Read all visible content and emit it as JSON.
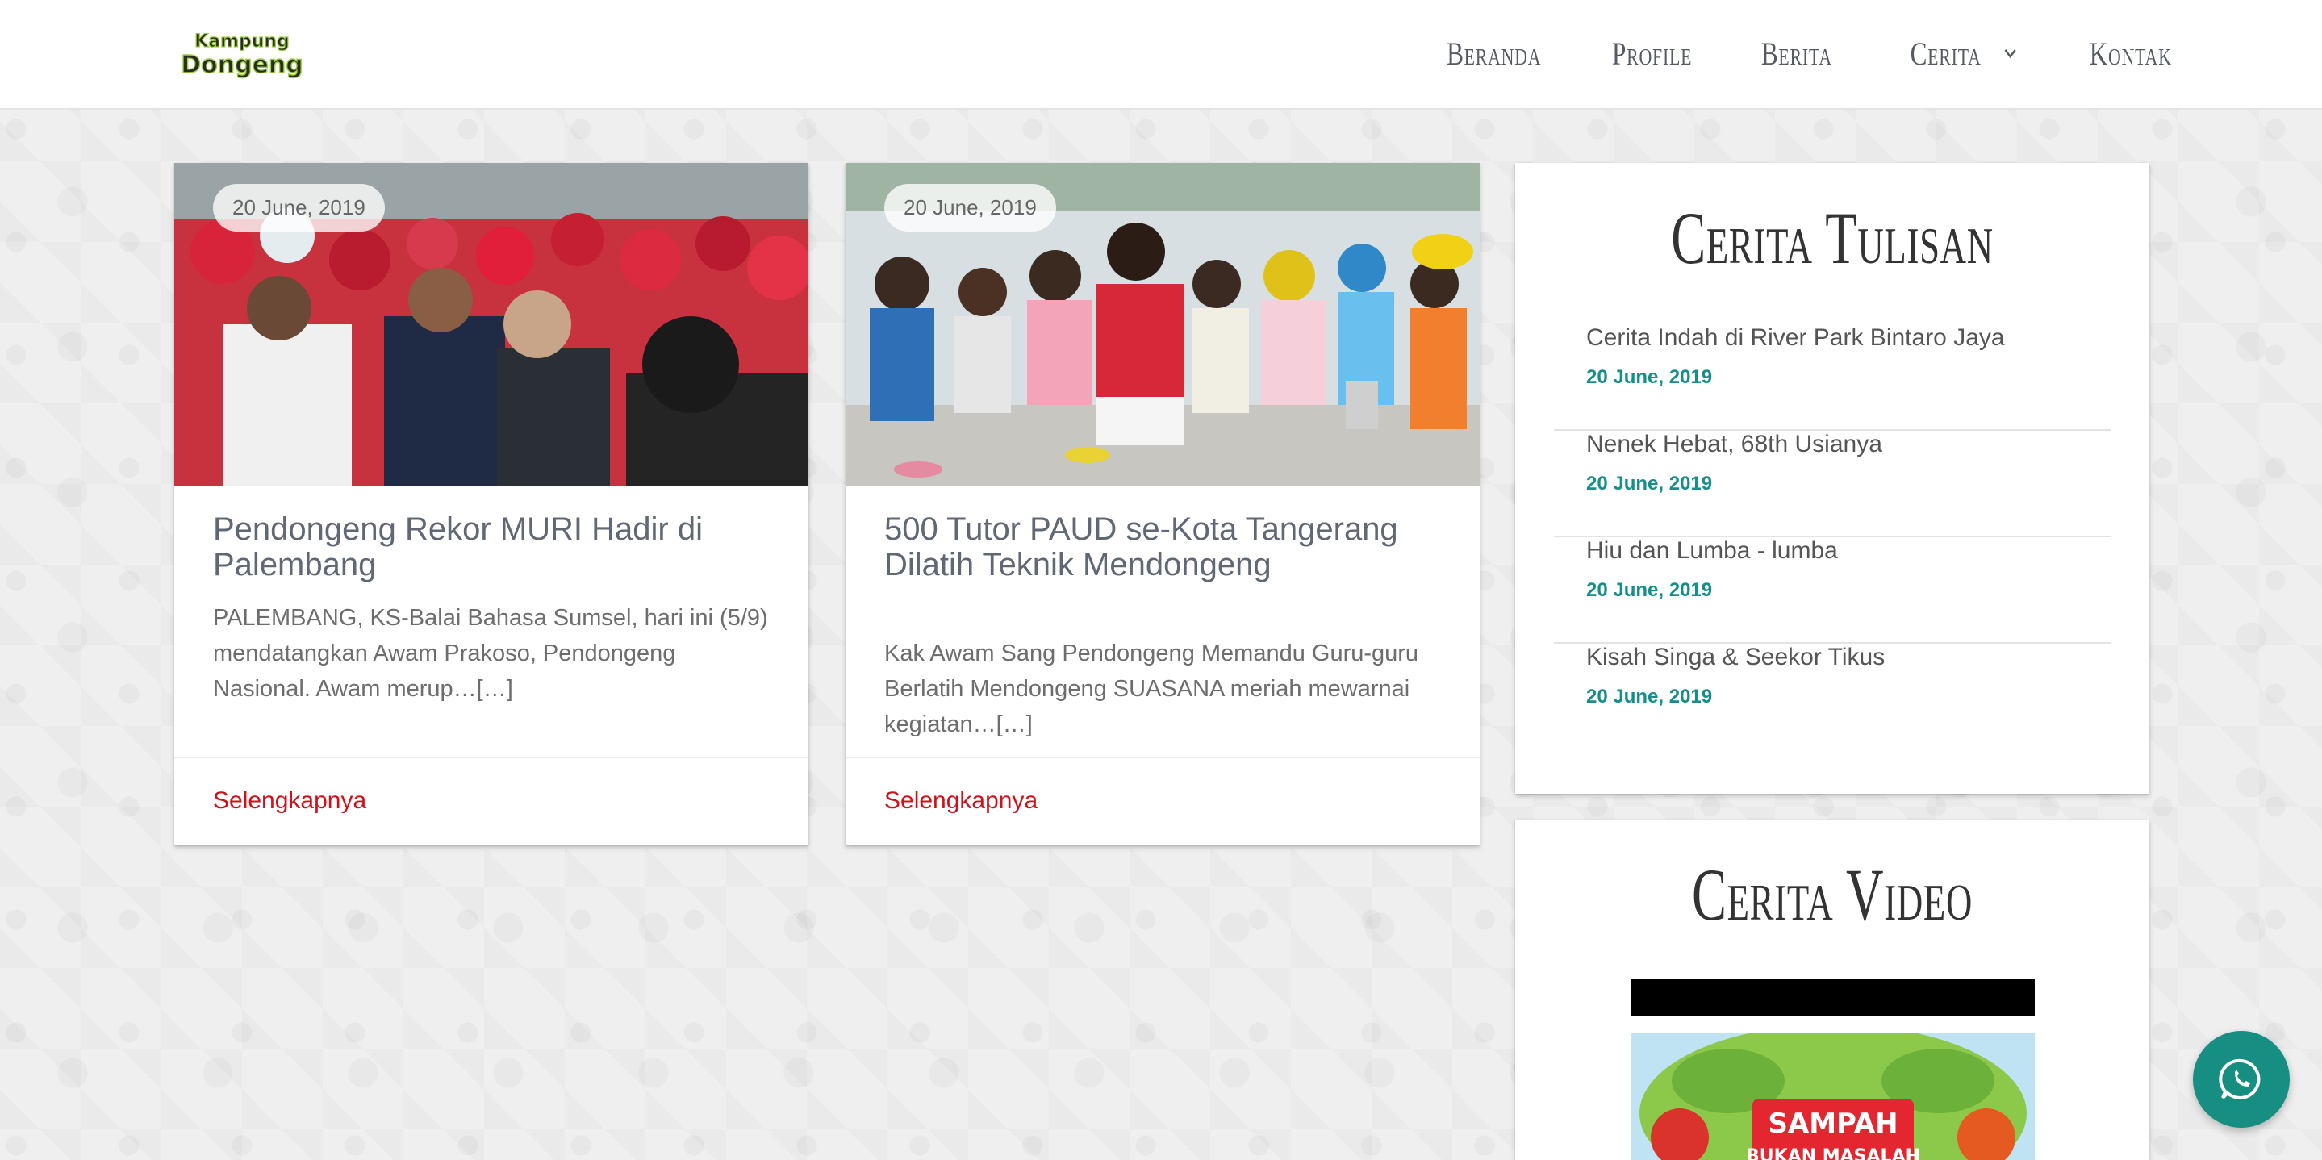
{
  "header": {
    "logo": {
      "line1": "Kampung",
      "line2": "Dongeng"
    },
    "nav": [
      {
        "label": "Beranda"
      },
      {
        "label": "Profile"
      },
      {
        "label": "Berita"
      },
      {
        "label": "Cerita"
      },
      {
        "label": "Kontak"
      }
    ]
  },
  "posts": [
    {
      "date": "20 June, 2019",
      "title": "Pendongeng Rekor MURI Hadir di Palembang",
      "excerpt": "PALEMBANG, KS-Balai Bahasa Sumsel, hari ini (5/9) mendatangkan Awam Prakoso, Pendongeng Nasional. Awam merup…[…]",
      "link": "Selengkapnya"
    },
    {
      "date": "20 June, 2019",
      "title": "500 Tutor PAUD se-Kota Tangerang Dilatih Teknik Mendongeng",
      "excerpt": "Kak Awam Sang Pendongeng Memandu Guru-guru Berlatih Mendongeng   SUASANA meriah mewarnai kegiatan…[…]",
      "link": "Selengkapnya"
    }
  ],
  "sidebar": {
    "written": {
      "title": "Cerita Tulisan",
      "items": [
        {
          "title": "Cerita Indah di River Park Bintaro Jaya",
          "date": "20 June, 2019"
        },
        {
          "title": "Nenek Hebat, 68th Usianya",
          "date": "20 June, 2019"
        },
        {
          "title": "Hiu dan Lumba - lumba",
          "date": "20 June, 2019"
        },
        {
          "title": "Kisah Singa & Seekor Tikus",
          "date": "20 June, 2019"
        }
      ]
    },
    "video": {
      "title": "Cerita Video",
      "thumb_line1": "SAMPAH",
      "thumb_line2": "BUKAN MASALAH"
    }
  },
  "colors": {
    "accent_red": "#d0101b",
    "date_teal": "#168e8a",
    "whatsapp": "#178e82"
  }
}
